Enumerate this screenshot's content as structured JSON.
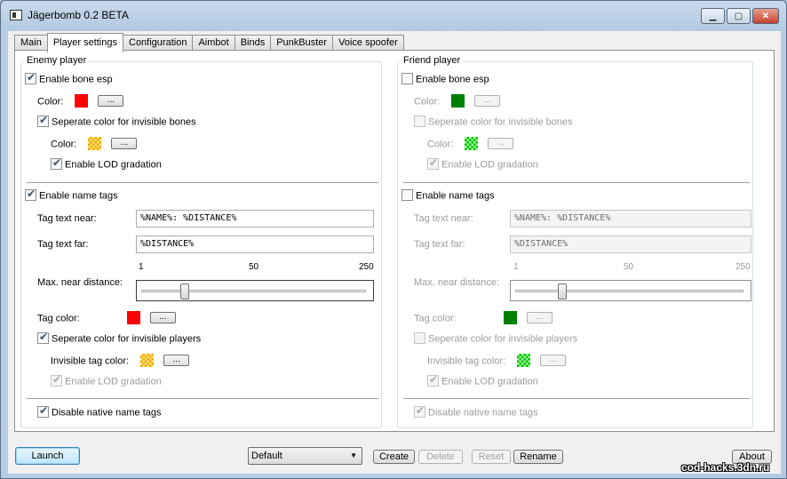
{
  "window": {
    "title": "Jägerbomb 0.2 BETA"
  },
  "tabs": [
    "Main",
    "Player settings",
    "Configuration",
    "Aimbot",
    "Binds",
    "PunkBuster",
    "Voice spoofer"
  ],
  "enemy": {
    "group_title": "Enemy player",
    "enable_bone_esp": "Enable bone esp",
    "color_label": "Color:",
    "color": "#ff0000",
    "separate_invisible_bones": "Seperate color for invisible bones",
    "invisible_color_label": "Color:",
    "invisible_color_a": "#f0a800",
    "invisible_color_b": "#ffe680",
    "enable_lod": "Enable LOD gradation",
    "enable_name_tags": "Enable name tags",
    "tag_near_label": "Tag text near:",
    "tag_near_value": "%NAME%: %DISTANCE%",
    "tag_far_label": "Tag text far:",
    "tag_far_value": "%DISTANCE%",
    "slider_min": "1",
    "slider_mid": "50",
    "slider_max": "250",
    "max_near_label": "Max. near distance:",
    "max_near_value": 50,
    "tag_color_label": "Tag color:",
    "tag_color": "#ff0000",
    "separate_invisible_players": "Seperate color for invisible players",
    "invisible_tag_color_label": "Invisible tag color:",
    "enable_lod_2": "Enable LOD gradation",
    "disable_native": "Disable native name tags"
  },
  "friend": {
    "group_title": "Friend player",
    "enable_bone_esp": "Enable bone esp",
    "color_label": "Color:",
    "color": "#008000",
    "separate_invisible_bones": "Seperate color for invisible bones",
    "invisible_color_label": "Color:",
    "invisible_color_a": "#00c000",
    "invisible_color_b": "#a0ffa0",
    "enable_lod": "Enable LOD gradation",
    "enable_name_tags": "Enable name tags",
    "tag_near_label": "Tag text near:",
    "tag_near_value": "%NAME%: %DISTANCE%",
    "tag_far_label": "Tag text far:",
    "tag_far_value": "%DISTANCE%",
    "slider_min": "1",
    "slider_mid": "50",
    "slider_max": "250",
    "max_near_label": "Max. near distance:",
    "max_near_value": 50,
    "tag_color_label": "Tag color:",
    "tag_color": "#008000",
    "separate_invisible_players": "Seperate color for invisible players",
    "invisible_tag_color_label": "Invisible tag color:",
    "enable_lod_2": "Enable LOD gradation",
    "disable_native": "Disable native name tags"
  },
  "picker_label": "...",
  "bottom": {
    "launch": "Launch",
    "profile": "Default",
    "create": "Create",
    "delete": "Delete",
    "reset": "Reset",
    "rename": "Rename",
    "about": "About"
  },
  "watermark": "cod-hacks.3dn.ru"
}
